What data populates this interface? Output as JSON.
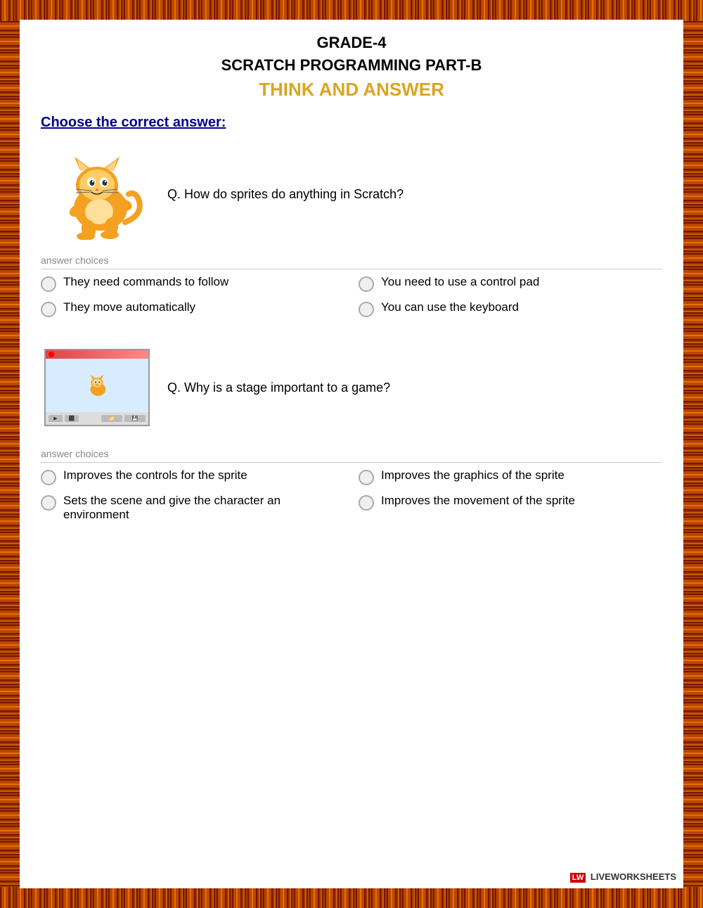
{
  "page": {
    "grade": "GRADE-4",
    "subject": "SCRATCH PROGRAMMING PART-B",
    "section": "THINK AND ANSWER",
    "instruction": "Choose the correct answer:",
    "questions": [
      {
        "id": "q1",
        "text": "Q. How do sprites do anything in Scratch?",
        "answer_choices_label": "answer choices",
        "choices": [
          {
            "id": "q1a",
            "text": "They need commands to follow",
            "col": 0
          },
          {
            "id": "q1b",
            "text": "You need to use a control pad",
            "col": 1
          },
          {
            "id": "q1c",
            "text": "They move automatically",
            "col": 0
          },
          {
            "id": "q1d",
            "text": "You can use the keyboard",
            "col": 1
          }
        ]
      },
      {
        "id": "q2",
        "text": "Q. Why is a stage important to a game?",
        "answer_choices_label": "answer choices",
        "choices": [
          {
            "id": "q2a",
            "text": "Improves the controls for the sprite",
            "col": 0
          },
          {
            "id": "q2b",
            "text": "Improves the graphics of the sprite",
            "col": 1
          },
          {
            "id": "q2c",
            "text": "Sets the scene and give the character an environment",
            "col": 0
          },
          {
            "id": "q2d",
            "text": "Improves the movement of the sprite",
            "col": 1
          }
        ]
      }
    ],
    "footer": {
      "brand": "LIVEWORKSHEETS",
      "logo_text": "LW"
    }
  }
}
